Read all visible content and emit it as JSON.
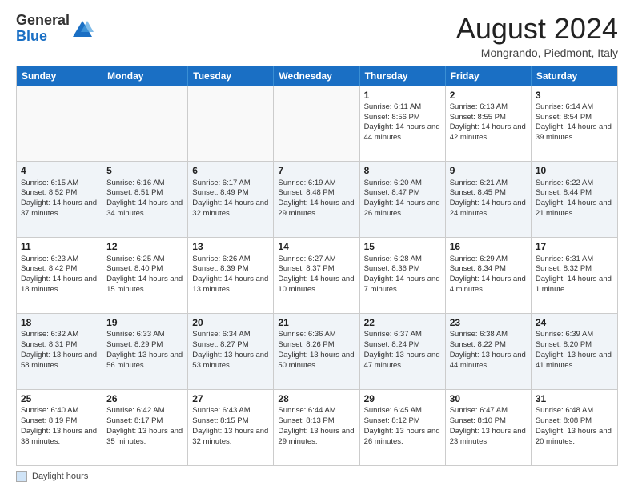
{
  "logo": {
    "general": "General",
    "blue": "Blue"
  },
  "title": "August 2024",
  "location": "Mongrando, Piedmont, Italy",
  "days_of_week": [
    "Sunday",
    "Monday",
    "Tuesday",
    "Wednesday",
    "Thursday",
    "Friday",
    "Saturday"
  ],
  "footer_label": "Daylight hours",
  "weeks": [
    [
      {
        "day": "",
        "info": ""
      },
      {
        "day": "",
        "info": ""
      },
      {
        "day": "",
        "info": ""
      },
      {
        "day": "",
        "info": ""
      },
      {
        "day": "1",
        "info": "Sunrise: 6:11 AM\nSunset: 8:56 PM\nDaylight: 14 hours and 44 minutes."
      },
      {
        "day": "2",
        "info": "Sunrise: 6:13 AM\nSunset: 8:55 PM\nDaylight: 14 hours and 42 minutes."
      },
      {
        "day": "3",
        "info": "Sunrise: 6:14 AM\nSunset: 8:54 PM\nDaylight: 14 hours and 39 minutes."
      }
    ],
    [
      {
        "day": "4",
        "info": "Sunrise: 6:15 AM\nSunset: 8:52 PM\nDaylight: 14 hours and 37 minutes."
      },
      {
        "day": "5",
        "info": "Sunrise: 6:16 AM\nSunset: 8:51 PM\nDaylight: 14 hours and 34 minutes."
      },
      {
        "day": "6",
        "info": "Sunrise: 6:17 AM\nSunset: 8:49 PM\nDaylight: 14 hours and 32 minutes."
      },
      {
        "day": "7",
        "info": "Sunrise: 6:19 AM\nSunset: 8:48 PM\nDaylight: 14 hours and 29 minutes."
      },
      {
        "day": "8",
        "info": "Sunrise: 6:20 AM\nSunset: 8:47 PM\nDaylight: 14 hours and 26 minutes."
      },
      {
        "day": "9",
        "info": "Sunrise: 6:21 AM\nSunset: 8:45 PM\nDaylight: 14 hours and 24 minutes."
      },
      {
        "day": "10",
        "info": "Sunrise: 6:22 AM\nSunset: 8:44 PM\nDaylight: 14 hours and 21 minutes."
      }
    ],
    [
      {
        "day": "11",
        "info": "Sunrise: 6:23 AM\nSunset: 8:42 PM\nDaylight: 14 hours and 18 minutes."
      },
      {
        "day": "12",
        "info": "Sunrise: 6:25 AM\nSunset: 8:40 PM\nDaylight: 14 hours and 15 minutes."
      },
      {
        "day": "13",
        "info": "Sunrise: 6:26 AM\nSunset: 8:39 PM\nDaylight: 14 hours and 13 minutes."
      },
      {
        "day": "14",
        "info": "Sunrise: 6:27 AM\nSunset: 8:37 PM\nDaylight: 14 hours and 10 minutes."
      },
      {
        "day": "15",
        "info": "Sunrise: 6:28 AM\nSunset: 8:36 PM\nDaylight: 14 hours and 7 minutes."
      },
      {
        "day": "16",
        "info": "Sunrise: 6:29 AM\nSunset: 8:34 PM\nDaylight: 14 hours and 4 minutes."
      },
      {
        "day": "17",
        "info": "Sunrise: 6:31 AM\nSunset: 8:32 PM\nDaylight: 14 hours and 1 minute."
      }
    ],
    [
      {
        "day": "18",
        "info": "Sunrise: 6:32 AM\nSunset: 8:31 PM\nDaylight: 13 hours and 58 minutes."
      },
      {
        "day": "19",
        "info": "Sunrise: 6:33 AM\nSunset: 8:29 PM\nDaylight: 13 hours and 56 minutes."
      },
      {
        "day": "20",
        "info": "Sunrise: 6:34 AM\nSunset: 8:27 PM\nDaylight: 13 hours and 53 minutes."
      },
      {
        "day": "21",
        "info": "Sunrise: 6:36 AM\nSunset: 8:26 PM\nDaylight: 13 hours and 50 minutes."
      },
      {
        "day": "22",
        "info": "Sunrise: 6:37 AM\nSunset: 8:24 PM\nDaylight: 13 hours and 47 minutes."
      },
      {
        "day": "23",
        "info": "Sunrise: 6:38 AM\nSunset: 8:22 PM\nDaylight: 13 hours and 44 minutes."
      },
      {
        "day": "24",
        "info": "Sunrise: 6:39 AM\nSunset: 8:20 PM\nDaylight: 13 hours and 41 minutes."
      }
    ],
    [
      {
        "day": "25",
        "info": "Sunrise: 6:40 AM\nSunset: 8:19 PM\nDaylight: 13 hours and 38 minutes."
      },
      {
        "day": "26",
        "info": "Sunrise: 6:42 AM\nSunset: 8:17 PM\nDaylight: 13 hours and 35 minutes."
      },
      {
        "day": "27",
        "info": "Sunrise: 6:43 AM\nSunset: 8:15 PM\nDaylight: 13 hours and 32 minutes."
      },
      {
        "day": "28",
        "info": "Sunrise: 6:44 AM\nSunset: 8:13 PM\nDaylight: 13 hours and 29 minutes."
      },
      {
        "day": "29",
        "info": "Sunrise: 6:45 AM\nSunset: 8:12 PM\nDaylight: 13 hours and 26 minutes."
      },
      {
        "day": "30",
        "info": "Sunrise: 6:47 AM\nSunset: 8:10 PM\nDaylight: 13 hours and 23 minutes."
      },
      {
        "day": "31",
        "info": "Sunrise: 6:48 AM\nSunset: 8:08 PM\nDaylight: 13 hours and 20 minutes."
      }
    ]
  ]
}
